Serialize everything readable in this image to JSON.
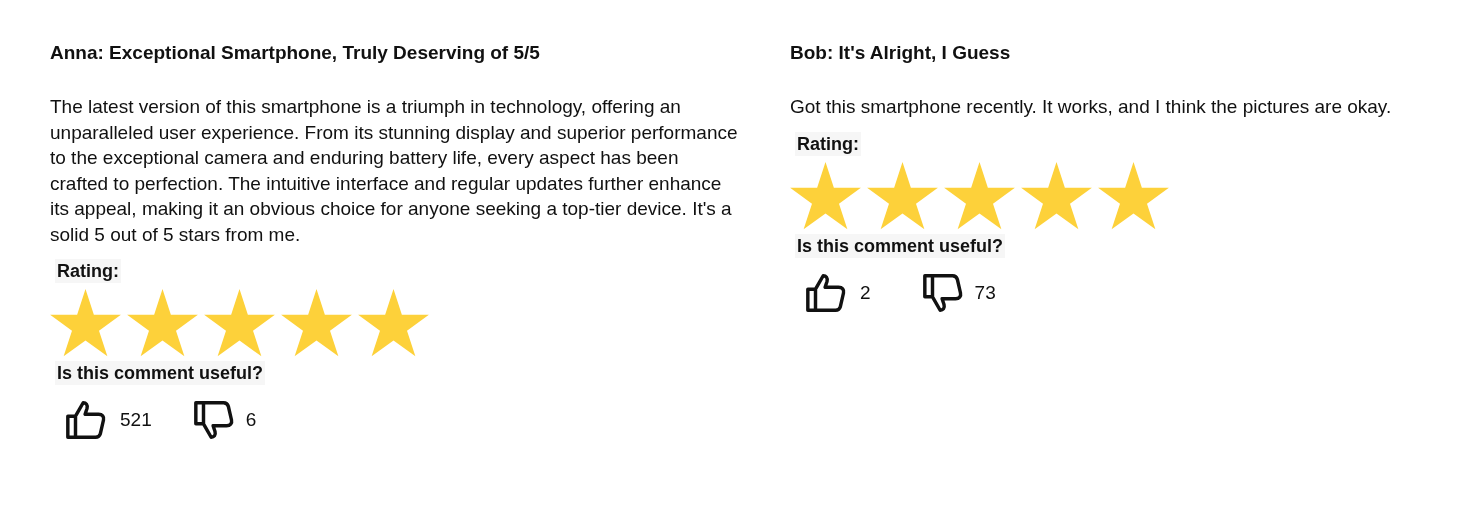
{
  "reviews": [
    {
      "title": "Anna: Exceptional Smartphone, Truly Deserving of 5/5",
      "body": "The latest version of this smartphone is a triumph in technology, offering an unparalleled user experience. From its stunning display and superior performance to the exceptional camera and enduring battery life, every aspect has been crafted to perfection. The intuitive interface and regular updates further enhance its appeal, making it an obvious choice for anyone seeking a top-tier device. It's a solid 5 out of 5 stars from me.",
      "rating_label": "Rating:",
      "stars": 5,
      "useful_label": "Is this comment useful?",
      "likes": "521",
      "dislikes": "6"
    },
    {
      "title": "Bob: It's Alright, I Guess",
      "body": "Got this smartphone recently. It works, and I think the pictures are okay.",
      "rating_label": "Rating:",
      "stars": 5,
      "useful_label": "Is this comment useful?",
      "likes": "2",
      "dislikes": "73"
    }
  ]
}
